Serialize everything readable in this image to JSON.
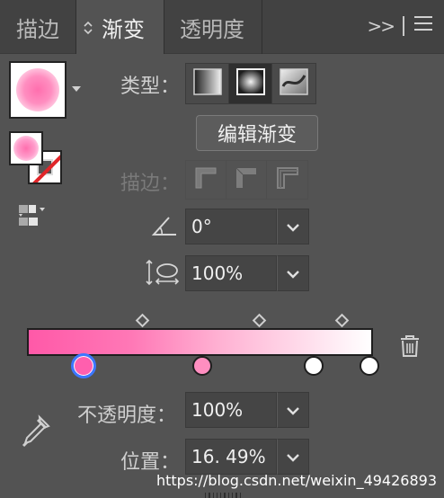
{
  "tabs": [
    {
      "label": "描边",
      "active": false
    },
    {
      "label": "渐变",
      "active": true
    },
    {
      "label": "透明度",
      "active": false
    }
  ],
  "toolbar": {
    "expand_glyph": ">>",
    "menu_icon": "hamburger-menu-icon"
  },
  "type": {
    "label": "类型：",
    "options": [
      "linear-gradient-icon",
      "radial-gradient-icon",
      "freeform-gradient-icon"
    ],
    "selected": "radial-gradient-icon"
  },
  "edit_button_label": "编辑渐变",
  "stroke": {
    "label": "描边：",
    "disabled": true
  },
  "angle": {
    "value": "0°",
    "icon": "angle-icon"
  },
  "aspect": {
    "value": "100%",
    "icon": "aspect-ratio-icon"
  },
  "gradient": {
    "colors": {
      "start": "#ff59a8",
      "end": "#ffffff",
      "accent": "#3b77ff"
    },
    "stops": [
      {
        "color": "#ff5fae",
        "selected": true
      },
      {
        "color": "#ff8ec0",
        "selected": false
      },
      {
        "color": "#ffffff",
        "selected": false
      },
      {
        "color": "#ffffff",
        "selected": false
      }
    ]
  },
  "opacity": {
    "label": "不透明度：",
    "value": "100%"
  },
  "location": {
    "label": "位置：",
    "value": "16. 49%"
  },
  "watermark": "https://blog.csdn.net/weixin_49426893"
}
